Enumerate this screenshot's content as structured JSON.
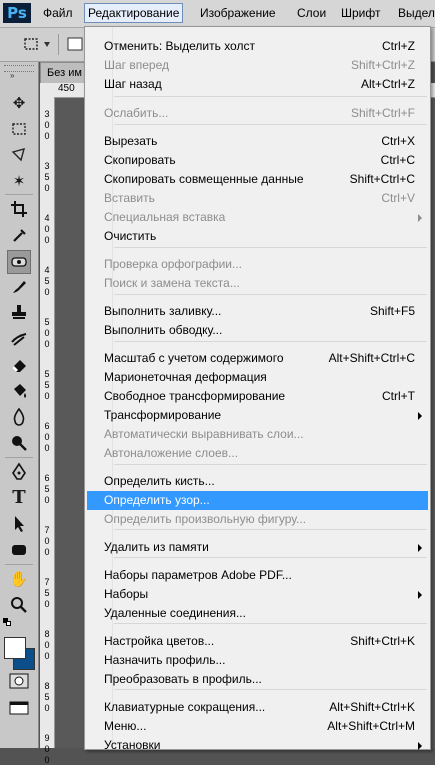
{
  "app": {
    "logo": "Ps"
  },
  "menubar": {
    "items": [
      {
        "label": "Файл"
      },
      {
        "label": "Редактирование"
      },
      {
        "label": "Изображение"
      },
      {
        "label": "Слои"
      },
      {
        "label": "Шрифт"
      },
      {
        "label": "Выделе"
      }
    ]
  },
  "document": {
    "tab_label": "Без им"
  },
  "rulers": {
    "horizontal_label": "450",
    "vertical_labels": [
      "3",
      "0",
      "0",
      "3",
      "5",
      "0",
      "4",
      "0",
      "0",
      "4",
      "5",
      "0",
      "5",
      "0",
      "0",
      "5",
      "5",
      "0",
      "6",
      "0",
      "0",
      "6",
      "5",
      "0",
      "7",
      "0",
      "0",
      "7",
      "5",
      "0",
      "8",
      "0",
      "0",
      "8",
      "5",
      "0",
      "9",
      "0",
      "0"
    ]
  },
  "edit_menu": {
    "items": [
      {
        "label": "Отменить: Выделить холст",
        "shortcut": "Ctrl+Z",
        "enabled": true
      },
      {
        "label": "Шаг вперед",
        "shortcut": "Shift+Ctrl+Z",
        "enabled": false
      },
      {
        "label": "Шаг назад",
        "shortcut": "Alt+Ctrl+Z",
        "enabled": true
      },
      {
        "label": "Ослабить...",
        "shortcut": "Shift+Ctrl+F",
        "enabled": false
      },
      {
        "label": "Вырезать",
        "shortcut": "Ctrl+X",
        "enabled": true
      },
      {
        "label": "Скопировать",
        "shortcut": "Ctrl+C",
        "enabled": true
      },
      {
        "label": "Скопировать совмещенные данные",
        "shortcut": "Shift+Ctrl+C",
        "enabled": true
      },
      {
        "label": "Вставить",
        "shortcut": "Ctrl+V",
        "enabled": false
      },
      {
        "label": "Специальная вставка",
        "shortcut": "",
        "enabled": false,
        "submenu": true
      },
      {
        "label": "Очистить",
        "shortcut": "",
        "enabled": true
      },
      {
        "label": "Проверка орфографии...",
        "shortcut": "",
        "enabled": false
      },
      {
        "label": "Поиск и замена текста...",
        "shortcut": "",
        "enabled": false
      },
      {
        "label": "Выполнить заливку...",
        "shortcut": "Shift+F5",
        "enabled": true
      },
      {
        "label": "Выполнить обводку...",
        "shortcut": "",
        "enabled": true
      },
      {
        "label": "Масштаб с учетом содержимого",
        "shortcut": "Alt+Shift+Ctrl+C",
        "enabled": true
      },
      {
        "label": "Марионеточная деформация",
        "shortcut": "",
        "enabled": true
      },
      {
        "label": "Свободное трансформирование",
        "shortcut": "Ctrl+T",
        "enabled": true
      },
      {
        "label": "Трансформирование",
        "shortcut": "",
        "enabled": true,
        "submenu": true
      },
      {
        "label": "Автоматически выравнивать слои...",
        "shortcut": "",
        "enabled": false
      },
      {
        "label": "Автоналожение слоев...",
        "shortcut": "",
        "enabled": false
      },
      {
        "label": "Определить кисть...",
        "shortcut": "",
        "enabled": true
      },
      {
        "label": "Определить узор...",
        "shortcut": "",
        "enabled": true,
        "highlighted": true
      },
      {
        "label": "Определить произвольную фигуру...",
        "shortcut": "",
        "enabled": false
      },
      {
        "label": "Удалить из памяти",
        "shortcut": "",
        "enabled": true,
        "submenu": true
      },
      {
        "label": "Наборы параметров Adobe PDF...",
        "shortcut": "",
        "enabled": true
      },
      {
        "label": "Наборы",
        "shortcut": "",
        "enabled": true,
        "submenu": true
      },
      {
        "label": "Удаленные соединения...",
        "shortcut": "",
        "enabled": true
      },
      {
        "label": "Настройка цветов...",
        "shortcut": "Shift+Ctrl+K",
        "enabled": true
      },
      {
        "label": "Назначить профиль...",
        "shortcut": "",
        "enabled": true
      },
      {
        "label": "Преобразовать в профиль...",
        "shortcut": "",
        "enabled": true
      },
      {
        "label": "Клавиатурные сокращения...",
        "shortcut": "Alt+Shift+Ctrl+K",
        "enabled": true
      },
      {
        "label": "Меню...",
        "shortcut": "Alt+Shift+Ctrl+M",
        "enabled": true
      },
      {
        "label": "Установки",
        "shortcut": "",
        "enabled": true,
        "submenu": true
      }
    ]
  },
  "colors": {
    "highlight": "#3399ff",
    "background_color_swatch": "#0b4e8a",
    "foreground_color_swatch": "#ffffff"
  },
  "toolbar": {
    "tools": [
      "move-tool-icon",
      "marquee-tool-icon",
      "lasso-tool-icon",
      "magic-wand-tool-icon",
      "crop-tool-icon",
      "eyedropper-tool-icon",
      "spot-healing-tool-icon",
      "brush-tool-icon",
      "clone-stamp-tool-icon",
      "history-brush-tool-icon",
      "eraser-tool-icon",
      "paint-bucket-tool-icon",
      "blur-tool-icon",
      "dodge-tool-icon",
      "pen-tool-icon",
      "type-tool-icon",
      "path-selection-tool-icon",
      "shape-tool-icon",
      "hand-tool-icon",
      "zoom-tool-icon"
    ]
  }
}
